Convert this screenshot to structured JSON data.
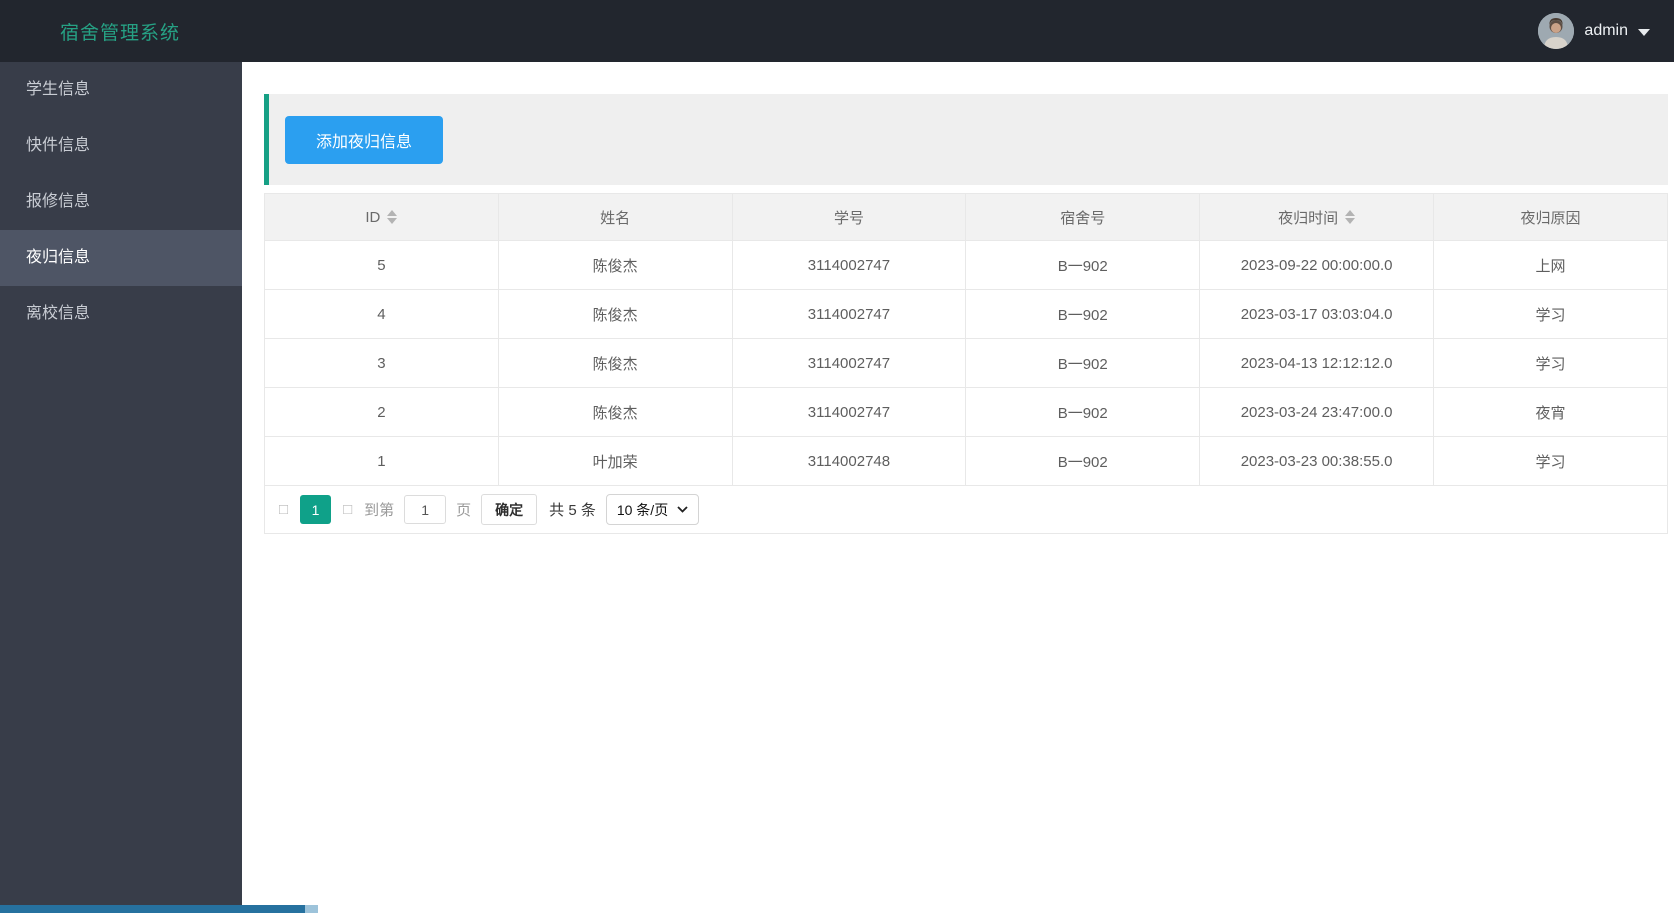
{
  "header": {
    "title": "宿舍管理系统",
    "user_name": "admin"
  },
  "sidebar": {
    "items": [
      {
        "label": "学生信息",
        "active": false
      },
      {
        "label": "快件信息",
        "active": false
      },
      {
        "label": "报修信息",
        "active": false
      },
      {
        "label": "夜归信息",
        "active": true
      },
      {
        "label": "离校信息",
        "active": false
      }
    ]
  },
  "toolbar": {
    "add_button_label": "添加夜归信息"
  },
  "table": {
    "columns": [
      {
        "label": "ID",
        "sortable": true
      },
      {
        "label": "姓名",
        "sortable": false
      },
      {
        "label": "学号",
        "sortable": false
      },
      {
        "label": "宿舍号",
        "sortable": false
      },
      {
        "label": "夜归时间",
        "sortable": true
      },
      {
        "label": "夜归原因",
        "sortable": false
      }
    ],
    "rows": [
      [
        "5",
        "陈俊杰",
        "3114002747",
        "B一902",
        "2023-09-22 00:00:00.0",
        "上网"
      ],
      [
        "4",
        "陈俊杰",
        "3114002747",
        "B一902",
        "2023-03-17 03:03:04.0",
        "学习"
      ],
      [
        "3",
        "陈俊杰",
        "3114002747",
        "B一902",
        "2023-04-13 12:12:12.0",
        "学习"
      ],
      [
        "2",
        "陈俊杰",
        "3114002747",
        "B一902",
        "2023-03-24 23:47:00.0",
        "夜宵"
      ],
      [
        "1",
        "叶加荣",
        "3114002748",
        "B一902",
        "2023-03-23 00:38:55.0",
        "学习"
      ]
    ]
  },
  "pagination": {
    "prev_glyph": "□",
    "current_page": "1",
    "next_glyph": "□",
    "goto_prefix": "到第",
    "goto_value": "1",
    "goto_suffix": "页",
    "confirm_label": "确定",
    "total_label": "共 5 条",
    "page_size_label": "10 条/页"
  },
  "colors": {
    "header_bg": "#22262e",
    "title_teal": "#26a184",
    "sidebar_bg": "#383d49",
    "sidebar_active_bg": "#4e5565",
    "accent_teal": "#16a085",
    "primary_button_blue": "#2b9ff0",
    "active_page_teal": "#0fa189",
    "bottom_bar_blue": "#26719f"
  }
}
